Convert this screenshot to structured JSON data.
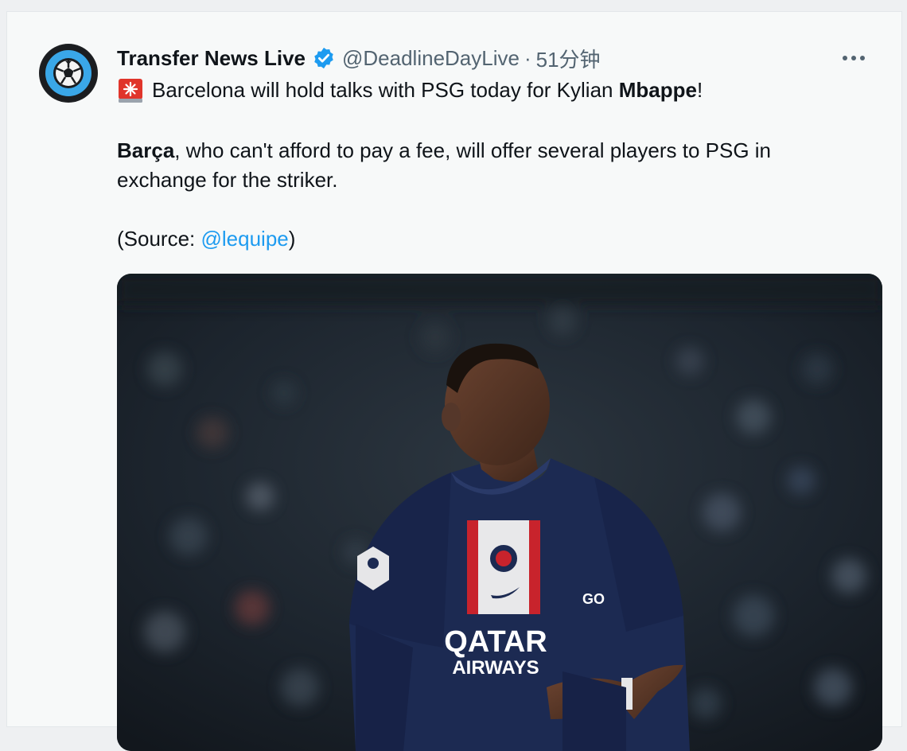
{
  "tweet": {
    "author_name": "Transfer News Live",
    "handle": "@DeadlineDayLive",
    "separator": "·",
    "time": "51分钟",
    "line1_prefix": "Barcelona will hold talks with PSG today for Kylian ",
    "line1_bold": "Mbappe",
    "line1_suffix": "!",
    "para2_bold": "Barça",
    "para2_rest": ", who can't afford to pay a fee, will offer several players to PSG in exchange for the striker.",
    "source_prefix": "(Source: ",
    "source_link": "@lequipe",
    "source_suffix": ")",
    "jersey_sponsor_1": "QATAR",
    "jersey_sponsor_2": "AIRWAYS",
    "jersey_sleeve": "GO"
  },
  "icons": {
    "avatar": "soccer-ball-icon",
    "verified": "verified-badge-icon",
    "more": "more-horizontal-icon",
    "siren": "siren-emoji-icon"
  },
  "colors": {
    "link": "#1d9bf0",
    "verified": "#1d9bf0",
    "avatar_ring": "#3aa7e8"
  }
}
